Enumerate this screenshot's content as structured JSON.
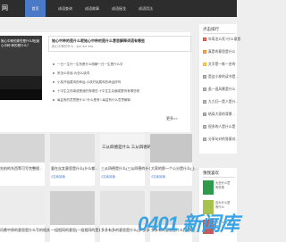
{
  "nav": {
    "logo": "网",
    "items": [
      "首页",
      "成语查询",
      "成语故事",
      "成语接龙",
      "成语用法"
    ]
  },
  "featured": {
    "image_caption": "她心中种的那些是什么呢(她心中种 种的是什么？",
    "headline": "她心中种的是什么呢她心中种的是什么意思解释词语有哪些",
    "subline": "她心中种的什么 - you are sha..."
  },
  "list_items": [
    "一日一生行一生有是什么明解一日一生是什么字",
    "贵怎么你读-为怎么读词",
    "小孩开始属鸡的命运-小孩开始属鸡的命运好吗",
    "十中生生肉填或是我的有哪些-十中生生杂偏或是肉有哪些呢",
    "每盆有的意思是什么?什么是有?-每盆有什么意思解释"
  ],
  "more_label": "更多>>",
  "cards_row1": [
    {
      "title": "先拍的东西等可写完整理...",
      "meta": ""
    },
    {
      "title": "要在丝女意思是什么(什么都...",
      "meta": "4文库阅读"
    },
    {
      "title": "三从四德是什么(三从四德的什么...",
      "meta": "4文库阅读"
    },
    {
      "title": "大家的那一个公分是什么(上...",
      "meta": "4文库阅读"
    }
  ],
  "card3_image_text": "三从四德是什么  三从四德的...",
  "cards_row2": [
    {
      "title": "问鼎中原的意思是什么写的相关..."
    },
    {
      "title": "一组相同的意思(一组相同的是意..."
    },
    {
      "title": "多多有多的意思是什么(多-多多..."
    },
    {
      "title": "多多有的意思是什么(多多是..."
    }
  ],
  "sidebar": {
    "title": "点击排行",
    "ranks": [
      {
        "n": "1",
        "text": "年寿怎么死?什么意思",
        "color": "#e0483c"
      },
      {
        "n": "2",
        "text": "真是的意思是什么",
        "color": "#f28a30"
      },
      {
        "n": "3",
        "text": "文字是一款一名的",
        "color": "#f5b82e"
      },
      {
        "n": "4",
        "text": "是这小样的读书是...",
        "color": "#999999"
      },
      {
        "n": "5",
        "text": "逛一逛风景是什么",
        "color": "#999999"
      },
      {
        "n": "6",
        "text": "九九归一是人是什...",
        "color": "#999999"
      },
      {
        "n": "7",
        "text": "结局大家的背景...",
        "color": "#999999"
      },
      {
        "n": "8",
        "text": "很多的人是什么是",
        "color": "#999999"
      },
      {
        "n": "9",
        "text": "分享句对的答案对...",
        "color": "#999999"
      }
    ]
  },
  "sidebar_recommend": {
    "title": "猜我喜欢",
    "items": [
      {
        "text": "大怎什么意\n有些事",
        "color": "#2e9a4c"
      },
      {
        "text": "百大什么是\n有什么",
        "color": "#a9c24f"
      },
      {
        "text": "好怎么读\n是什么",
        "color": "#c45a5a"
      }
    ]
  },
  "watermark": "0401 新闻库"
}
